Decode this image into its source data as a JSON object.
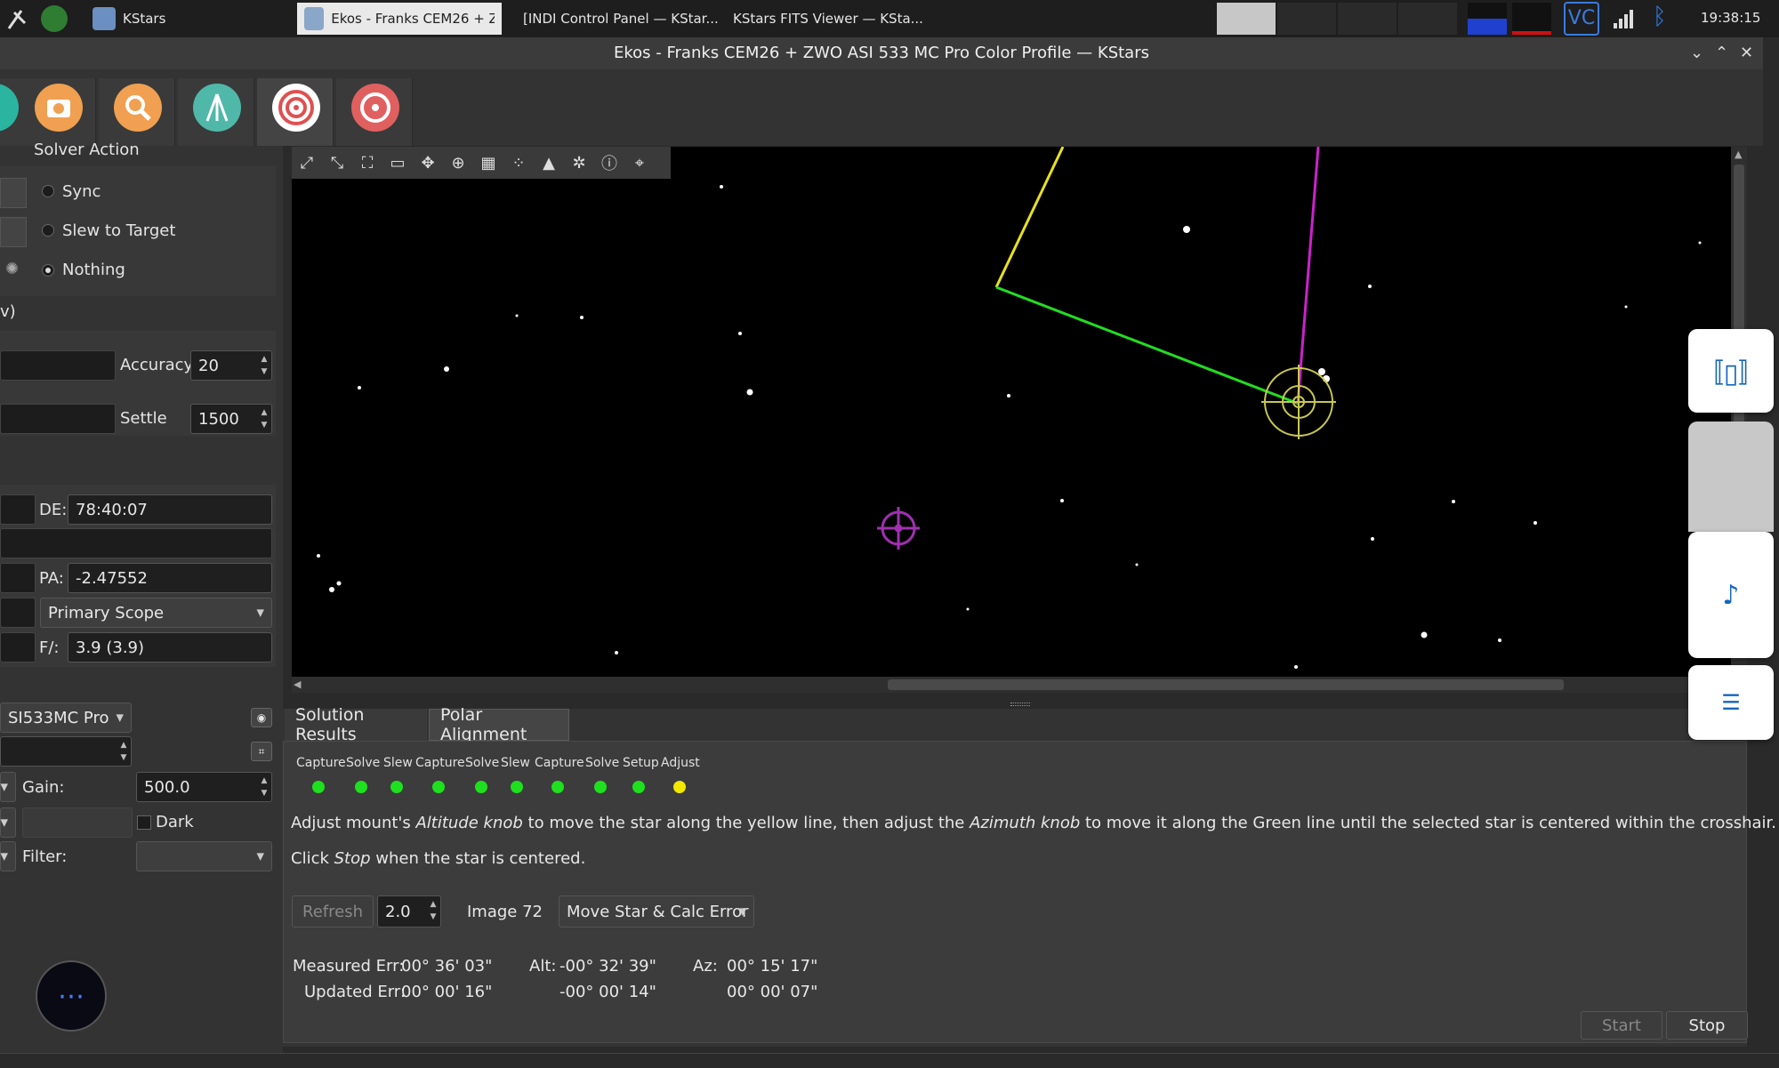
{
  "taskbar": {
    "apps": [
      {
        "label": "KStars"
      },
      {
        "label": "Ekos - Franks CEM26 + ZW..."
      },
      {
        "label": "[INDI Control Panel — KStar..."
      },
      {
        "label": "KStars FITS Viewer — KSta..."
      }
    ],
    "clock": "19:38:15",
    "tray_text": "VC"
  },
  "window": {
    "title": "Ekos - Franks CEM26 + ZWO ASI 533 MC Pro Color Profile — KStars"
  },
  "solver_action": {
    "header": "Solver Action",
    "options": [
      "Sync",
      "Slew to Target",
      "Nothing"
    ],
    "selected": "Nothing"
  },
  "left_panel": {
    "partial_label": "v)",
    "accuracy_label": "Accuracy",
    "accuracy_value": "20",
    "settle_label": "Settle",
    "settle_value": "1500",
    "de_label": "DE:",
    "de_value": "78:40:07",
    "pa_label": "PA:",
    "pa_value": "-2.47552",
    "scope_value": "Primary Scope",
    "f_label": "F/:",
    "f_value": "3.9 (3.9)",
    "camera_value": "SI533MC Pro",
    "gain_label": "Gain:",
    "gain_value": "500.0",
    "dark_label": "Dark",
    "filter_label": "Filter:"
  },
  "tabs": {
    "solution": "Solution Results",
    "polar": "Polar Alignment"
  },
  "stages": [
    "Capture",
    "Solve",
    "Slew",
    "Capture",
    "Solve",
    "Slew",
    "Capture",
    "Solve",
    "Setup",
    "Adjust"
  ],
  "instructions": {
    "line1_a": "Adjust mount's ",
    "line1_b": "Altitude knob",
    "line1_c": " to move the star along the yellow line, then adjust the ",
    "line1_d": "Azimuth knob",
    "line1_e": " to move it along the Green line until the selected star is centered within the crosshair.",
    "line2_a": "Click ",
    "line2_b": "Stop",
    "line2_c": " when the star is centered."
  },
  "controls": {
    "refresh_label": "Refresh",
    "refresh_value": "2.0",
    "image_label": "Image 72",
    "mode_value": "Move Star & Calc Error"
  },
  "errors": {
    "measured_label": "Measured Err:",
    "measured_value": "00° 36' 03\"",
    "updated_label": "Updated Err:",
    "updated_value": "00° 00' 16\"",
    "alt_label": "Alt:",
    "alt_measured": "-00° 32' 39\"",
    "alt_updated": "-00° 00' 14\"",
    "az_label": "Az:",
    "az_measured": "00° 15' 17\"",
    "az_updated": "00° 00' 07\""
  },
  "buttons": {
    "start": "Start",
    "stop": "Stop"
  },
  "colors": {
    "led_green": "#1ee01e",
    "led_yellow": "#f2e800",
    "yellow_line": "#e8e020",
    "green_line": "#22dd22",
    "magenta_line": "#cc22cc",
    "float_icon": "#1565c0"
  }
}
